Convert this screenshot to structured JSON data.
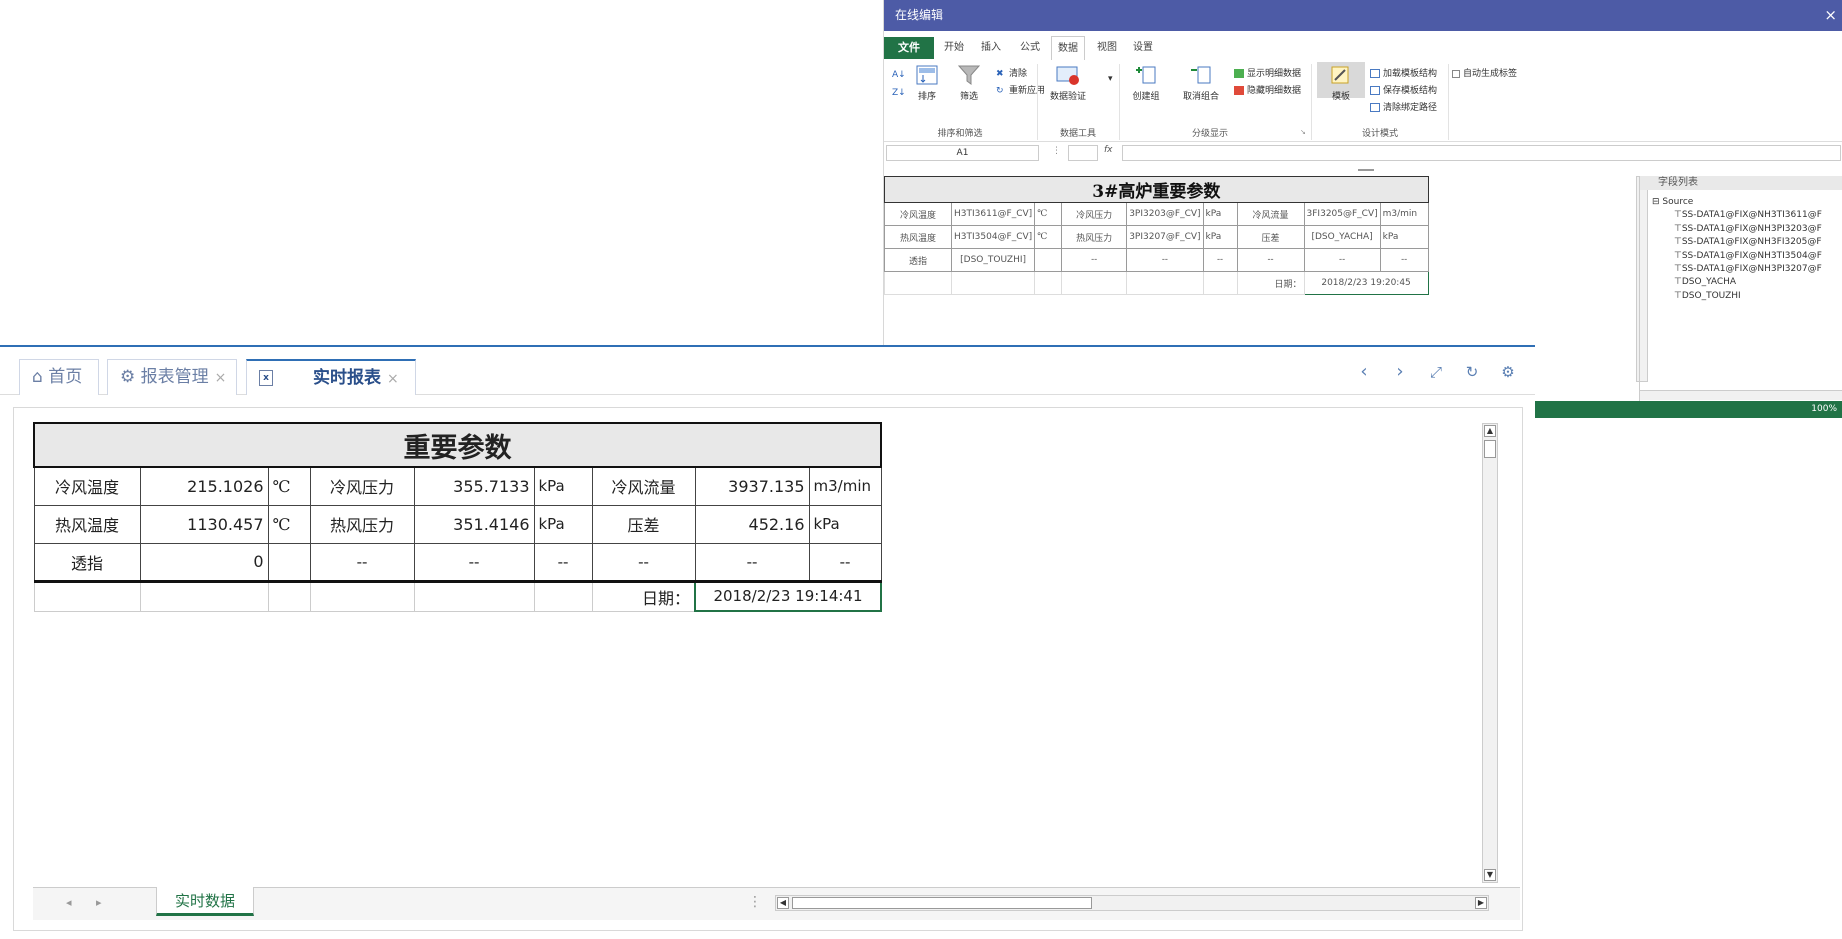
{
  "editor": {
    "title": "在线编辑",
    "close": "×",
    "ribbon_tabs": [
      "文件",
      "开始",
      "插入",
      "公式",
      "数据",
      "视图",
      "设置"
    ],
    "active_tab": "数据",
    "groups": {
      "sort_filter": {
        "label": "排序和筛选",
        "sort": "排序",
        "filter": "筛选",
        "clear": "清除",
        "reapply": "重新应用"
      },
      "data_tools": {
        "label": "数据工具",
        "validation": "数据验证"
      },
      "outline": {
        "label": "分级显示",
        "group": "创建组",
        "ungroup": "取消组合",
        "show_detail": "显示明细数据",
        "hide_detail": "隐藏明细数据"
      },
      "design": {
        "label": "设计模式",
        "template": "模板",
        "load_template": "加载模板结构",
        "save_template": "保存模板结构",
        "clear_binding": "清除绑定路径",
        "auto_label": "自动生成标签"
      }
    },
    "name_box": "A1",
    "fx": "fx",
    "sheet": {
      "title": "3#高炉重要参数",
      "rows": [
        [
          "冷风温度",
          "H3TI3611@F_CV]",
          "℃",
          "冷风压力",
          "3PI3203@F_CV]",
          "kPa",
          "冷风流量",
          "3FI3205@F_CV]",
          "m3/min"
        ],
        [
          "热风温度",
          "H3TI3504@F_CV]",
          "℃",
          "热风压力",
          "3PI3207@F_CV]",
          "kPa",
          "压差",
          "[DSO_YACHA]",
          "kPa"
        ],
        [
          "透指",
          "[DSO_TOUZHI]",
          "",
          "--",
          "--",
          "--",
          "--",
          "--",
          "--"
        ]
      ],
      "date_label": "日期：",
      "date_value": "2018/2/23 19:20:45"
    },
    "field_list": {
      "header": "字段列表",
      "root": "Source",
      "fields": [
        "SS-DATA1@FIX@NH3TI3611@F",
        "SS-DATA1@FIX@NH3PI3203@F",
        "SS-DATA1@FIX@NH3FI3205@F",
        "SS-DATA1@FIX@NH3TI3504@F",
        "SS-DATA1@FIX@NH3PI3207@F",
        "DSO_YACHA",
        "DSO_TOUZHI"
      ]
    },
    "zoom": "100%"
  },
  "app": {
    "tabs": [
      {
        "label": "首页"
      },
      {
        "label": "报表管理",
        "close": "×"
      },
      {
        "label": "实时报表",
        "close": "×"
      }
    ],
    "report": {
      "title": "重要参数",
      "rows": [
        [
          "冷风温度",
          "215.1026",
          "℃",
          "冷风压力",
          "355.7133",
          "kPa",
          "冷风流量",
          "3937.135",
          "m3/min"
        ],
        [
          "热风温度",
          "1130.457",
          "℃",
          "热风压力",
          "351.4146",
          "kPa",
          "压差",
          "452.16",
          "kPa"
        ],
        [
          "透指",
          "0",
          "",
          "--",
          "--",
          "--",
          "--",
          "--",
          "--"
        ]
      ],
      "date_label": "日期：",
      "date_value": "2018/2/23 19:14:41"
    },
    "sheet_tab": "实时数据"
  }
}
